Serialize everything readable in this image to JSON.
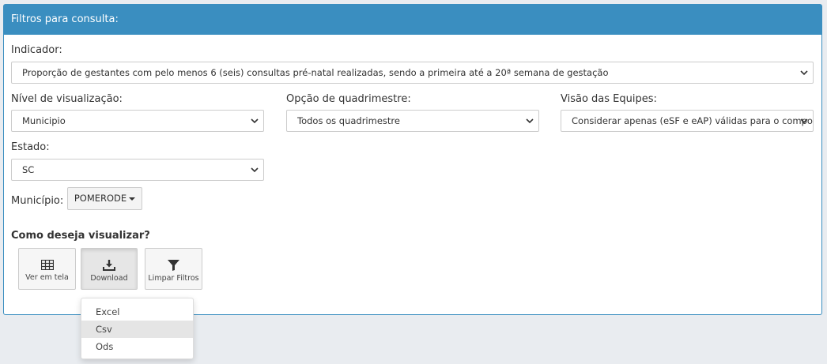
{
  "panel": {
    "title": "Filtros para consulta:"
  },
  "indicador": {
    "label": "Indicador:",
    "value": "Proporção de gestantes com pelo menos 6 (seis) consultas pré-natal realizadas, sendo a primeira até a 20ª semana de gestação"
  },
  "nivel": {
    "label": "Nível de visualização:",
    "value": "Municipio"
  },
  "quadrimestre": {
    "label": "Opção de quadrimestre:",
    "value": "Todos os quadrimestre"
  },
  "equipes": {
    "label": "Visão das Equipes:",
    "value": "Considerar apenas (eSF e eAP) válidas para o compor"
  },
  "estado": {
    "label": "Estado:",
    "value": "SC"
  },
  "municipio": {
    "label": "Município:",
    "value": "POMERODE"
  },
  "visualizar": {
    "heading": "Como deseja visualizar?",
    "buttons": [
      {
        "label": "Ver em tela",
        "icon": "table-icon"
      },
      {
        "label": "Download",
        "icon": "download-icon"
      },
      {
        "label": "Limpar Filtros",
        "icon": "filter-icon"
      }
    ]
  },
  "download_menu": {
    "items": [
      "Excel",
      "Csv",
      "Ods"
    ],
    "hovered": "Csv"
  },
  "colors": {
    "header": "#3a8ec0",
    "background": "#e9ecf0"
  }
}
